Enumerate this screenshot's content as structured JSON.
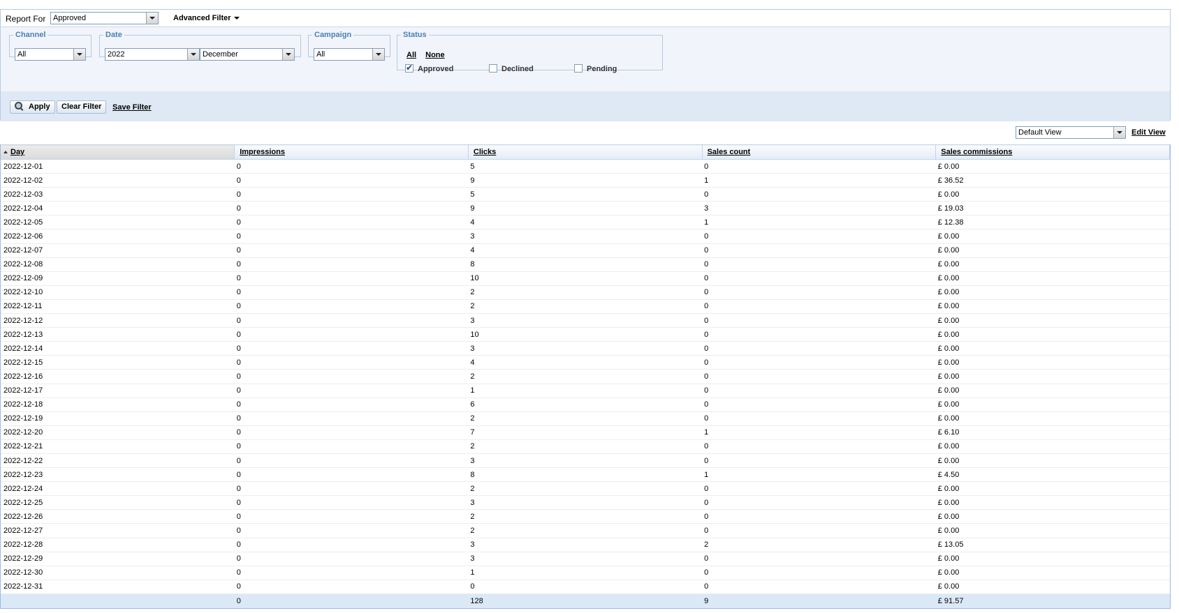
{
  "report_for": {
    "label": "Report For",
    "value": "Approved"
  },
  "advanced_filter_label": "Advanced Filter",
  "filters": {
    "channel": {
      "legend": "Channel",
      "value": "All"
    },
    "date": {
      "legend": "Date",
      "year": "2022",
      "month": "December"
    },
    "campaign": {
      "legend": "Campaign",
      "value": "All"
    },
    "status": {
      "legend": "Status",
      "all_label": "All",
      "none_label": "None",
      "options": [
        {
          "label": "Approved",
          "checked": true
        },
        {
          "label": "Declined",
          "checked": false
        },
        {
          "label": "Pending",
          "checked": false
        }
      ]
    }
  },
  "actions": {
    "apply": "Apply",
    "clear_filter": "Clear Filter",
    "save_filter": "Save Filter"
  },
  "view": {
    "selected": "Default View",
    "edit_label": "Edit View"
  },
  "table": {
    "columns": [
      "Day",
      "Impressions",
      "Clicks",
      "Sales count",
      "Sales commissions"
    ],
    "sort_column": "Day",
    "rows": [
      [
        "2022-12-01",
        "0",
        "5",
        "0",
        "£ 0.00"
      ],
      [
        "2022-12-02",
        "0",
        "9",
        "1",
        "£ 36.52"
      ],
      [
        "2022-12-03",
        "0",
        "5",
        "0",
        "£ 0.00"
      ],
      [
        "2022-12-04",
        "0",
        "9",
        "3",
        "£ 19.03"
      ],
      [
        "2022-12-05",
        "0",
        "4",
        "1",
        "£ 12.38"
      ],
      [
        "2022-12-06",
        "0",
        "3",
        "0",
        "£ 0.00"
      ],
      [
        "2022-12-07",
        "0",
        "4",
        "0",
        "£ 0.00"
      ],
      [
        "2022-12-08",
        "0",
        "8",
        "0",
        "£ 0.00"
      ],
      [
        "2022-12-09",
        "0",
        "10",
        "0",
        "£ 0.00"
      ],
      [
        "2022-12-10",
        "0",
        "2",
        "0",
        "£ 0.00"
      ],
      [
        "2022-12-11",
        "0",
        "2",
        "0",
        "£ 0.00"
      ],
      [
        "2022-12-12",
        "0",
        "3",
        "0",
        "£ 0.00"
      ],
      [
        "2022-12-13",
        "0",
        "10",
        "0",
        "£ 0.00"
      ],
      [
        "2022-12-14",
        "0",
        "3",
        "0",
        "£ 0.00"
      ],
      [
        "2022-12-15",
        "0",
        "4",
        "0",
        "£ 0.00"
      ],
      [
        "2022-12-16",
        "0",
        "2",
        "0",
        "£ 0.00"
      ],
      [
        "2022-12-17",
        "0",
        "1",
        "0",
        "£ 0.00"
      ],
      [
        "2022-12-18",
        "0",
        "6",
        "0",
        "£ 0.00"
      ],
      [
        "2022-12-19",
        "0",
        "2",
        "0",
        "£ 0.00"
      ],
      [
        "2022-12-20",
        "0",
        "7",
        "1",
        "£ 6.10"
      ],
      [
        "2022-12-21",
        "0",
        "2",
        "0",
        "£ 0.00"
      ],
      [
        "2022-12-22",
        "0",
        "3",
        "0",
        "£ 0.00"
      ],
      [
        "2022-12-23",
        "0",
        "8",
        "1",
        "£ 4.50"
      ],
      [
        "2022-12-24",
        "0",
        "2",
        "0",
        "£ 0.00"
      ],
      [
        "2022-12-25",
        "0",
        "3",
        "0",
        "£ 0.00"
      ],
      [
        "2022-12-26",
        "0",
        "2",
        "0",
        "£ 0.00"
      ],
      [
        "2022-12-27",
        "0",
        "2",
        "0",
        "£ 0.00"
      ],
      [
        "2022-12-28",
        "0",
        "3",
        "2",
        "£ 13.05"
      ],
      [
        "2022-12-29",
        "0",
        "3",
        "0",
        "£ 0.00"
      ],
      [
        "2022-12-30",
        "0",
        "1",
        "0",
        "£ 0.00"
      ],
      [
        "2022-12-31",
        "0",
        "0",
        "0",
        "£ 0.00"
      ]
    ],
    "totals": [
      "",
      "0",
      "128",
      "9",
      "£ 91.57"
    ]
  }
}
